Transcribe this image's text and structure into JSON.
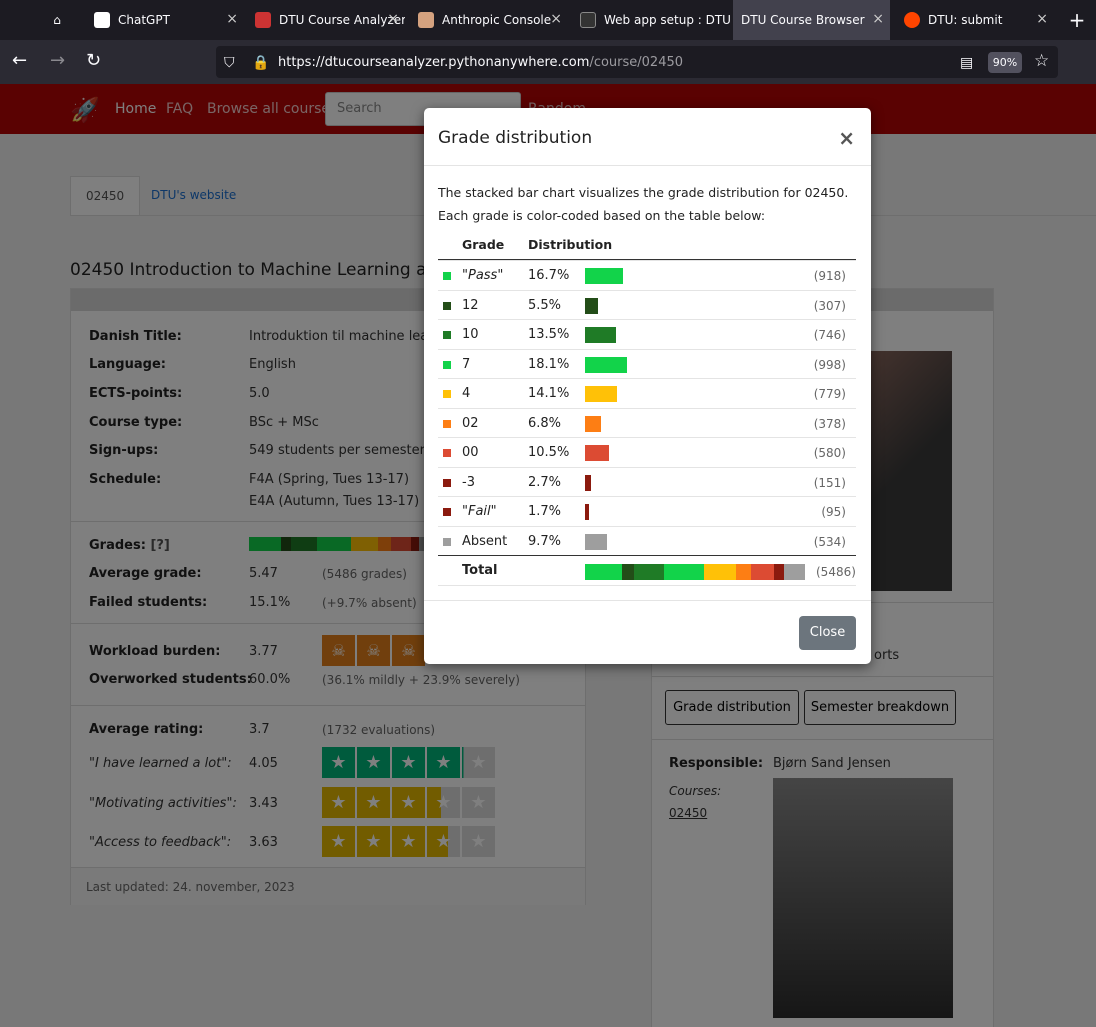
{
  "browser": {
    "tabs": [
      {
        "label": "ChatGPT"
      },
      {
        "label": "DTU Course Analyzer"
      },
      {
        "label": "Anthropic Console"
      },
      {
        "label": "Web app setup : DTU"
      },
      {
        "label": "DTU Course Browser"
      },
      {
        "label": "DTU: submit"
      }
    ],
    "url_host": "https://dtucourseanalyzer.pythonanywhere.com",
    "url_path": "/course/02450",
    "zoom": "90%"
  },
  "site": {
    "nav": {
      "home": "Home",
      "faq": "FAQ",
      "browse": "Browse all courses",
      "search_placeholder": "Search",
      "random": "Random"
    },
    "tabs": {
      "course": "02450",
      "website": "DTU's website"
    },
    "course_title": "02450 Introduction to Machine Learning and",
    "info": [
      {
        "label": "Danish Title:",
        "value": "Introduktion til machine learn"
      },
      {
        "label": "Language:",
        "value": "English"
      },
      {
        "label": "ECTS-points:",
        "value": "5.0"
      },
      {
        "label": "Course type:",
        "value": "BSc + MSc"
      },
      {
        "label": "Sign-ups:",
        "value": "549 students per semester"
      },
      {
        "label": "Schedule:",
        "value": "F4A (Spring, Tues 13-17)",
        "value2": "E4A (Autumn, Tues 13-17)"
      }
    ],
    "grades_label": "Grades:",
    "grades_help": "[?]",
    "avg_grade_label": "Average grade:",
    "avg_grade": "5.47",
    "avg_grade_note": "(5486 grades)",
    "failed_label": "Failed students:",
    "failed": "15.1%",
    "failed_note": "(+9.7% absent)",
    "workload_label": "Workload burden:",
    "workload": "3.77",
    "overworked_label": "Overworked students:",
    "overworked": "60.0%",
    "overworked_note": "(36.1% mildly + 23.9% severely)",
    "rating_label": "Average rating:",
    "rating": "3.7",
    "rating_note": "(1732 evaluations)",
    "ratings": [
      {
        "label": "\"I have learned a lot\":",
        "value": "4.05",
        "score": 4.05
      },
      {
        "label": "\"Motivating activities\":",
        "value": "3.43",
        "score": 3.43
      },
      {
        "label": "\"Access to feedback\":",
        "value": "3.63",
        "score": 3.63
      }
    ],
    "updated": "Last updated: 24. november, 2023",
    "side_text": "orts",
    "btn_grade": "Grade distribution",
    "btn_semester": "Semester breakdown",
    "responsible_label": "Responsible:",
    "responsible": "Bjørn Sand Jensen",
    "courses_label": "Courses:",
    "courses_link": "02450"
  },
  "modal": {
    "title": "Grade distribution",
    "close_x": "×",
    "description": "The stacked bar chart visualizes the grade distribution for 02450. Each grade is color-coded based on the table below:",
    "col_grade": "Grade",
    "col_dist": "Distribution",
    "total_label": "Total",
    "total_count": "(5486)",
    "close_button": "Close",
    "rows": [
      {
        "grade": "\"Pass\"",
        "italic": true,
        "pct": "16.7%",
        "share": 16.7,
        "count": "(918)",
        "color": "#12d34a"
      },
      {
        "grade": "12",
        "italic": false,
        "pct": "5.5%",
        "share": 5.5,
        "count": "(307)",
        "color": "#234d18"
      },
      {
        "grade": "10",
        "italic": false,
        "pct": "13.5%",
        "share": 13.5,
        "count": "(746)",
        "color": "#1f7b26"
      },
      {
        "grade": "7",
        "italic": false,
        "pct": "18.1%",
        "share": 18.1,
        "count": "(998)",
        "color": "#12d34a"
      },
      {
        "grade": "4",
        "italic": false,
        "pct": "14.1%",
        "share": 14.1,
        "count": "(779)",
        "color": "#ffc107"
      },
      {
        "grade": "02",
        "italic": false,
        "pct": "6.8%",
        "share": 6.8,
        "count": "(378)",
        "color": "#fd7e14"
      },
      {
        "grade": "00",
        "italic": false,
        "pct": "10.5%",
        "share": 10.5,
        "count": "(580)",
        "color": "#dc4b33"
      },
      {
        "grade": "-3",
        "italic": false,
        "pct": "2.7%",
        "share": 2.7,
        "count": "(151)",
        "color": "#8b1a0e"
      },
      {
        "grade": "\"Fail\"",
        "italic": true,
        "pct": "1.7%",
        "share": 1.7,
        "count": "(95)",
        "color": "#8b1a0e"
      },
      {
        "grade": "Absent",
        "italic": false,
        "pct": "9.7%",
        "share": 9.7,
        "count": "(534)",
        "color": "#9e9e9e"
      }
    ]
  }
}
